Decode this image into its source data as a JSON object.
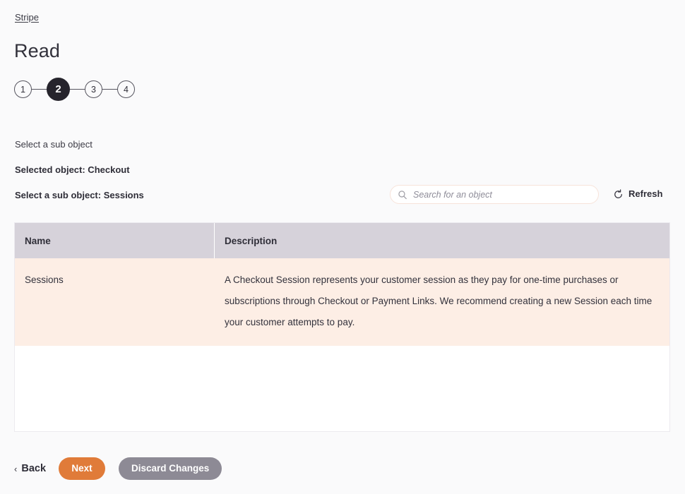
{
  "breadcrumb": {
    "label": "Stripe"
  },
  "header": {
    "title": "Read"
  },
  "stepper": {
    "steps": [
      {
        "label": "1",
        "active": false
      },
      {
        "label": "2",
        "active": true
      },
      {
        "label": "3",
        "active": false
      },
      {
        "label": "4",
        "active": false
      }
    ]
  },
  "form": {
    "hint": "Select a sub object",
    "selected_object": "Selected object: Checkout",
    "sub_object": "Select a sub object: Sessions"
  },
  "search": {
    "placeholder": "Search for an object",
    "value": "",
    "icon": "search-icon"
  },
  "refresh": {
    "label": "Refresh",
    "icon": "refresh-icon"
  },
  "table": {
    "columns": [
      "Name",
      "Description"
    ],
    "rows": [
      {
        "name": "Sessions",
        "description": "A Checkout Session represents your customer session as they pay for one-time purchases or subscriptions through Checkout or Payment Links. We recommend creating a new Session each time your customer attempts to pay."
      }
    ]
  },
  "footer": {
    "back_label": "Back",
    "back_icon": "chevron-left-icon",
    "next_label": "Next",
    "discard_label": "Discard Changes"
  },
  "colors": {
    "page_background": "#fafafb",
    "accent_orange": "#e07b39",
    "discard_gray": "#8d8a95",
    "row_selected": "#fdeee5",
    "table_header": "#d6d2da",
    "step_active": "#26242c"
  }
}
